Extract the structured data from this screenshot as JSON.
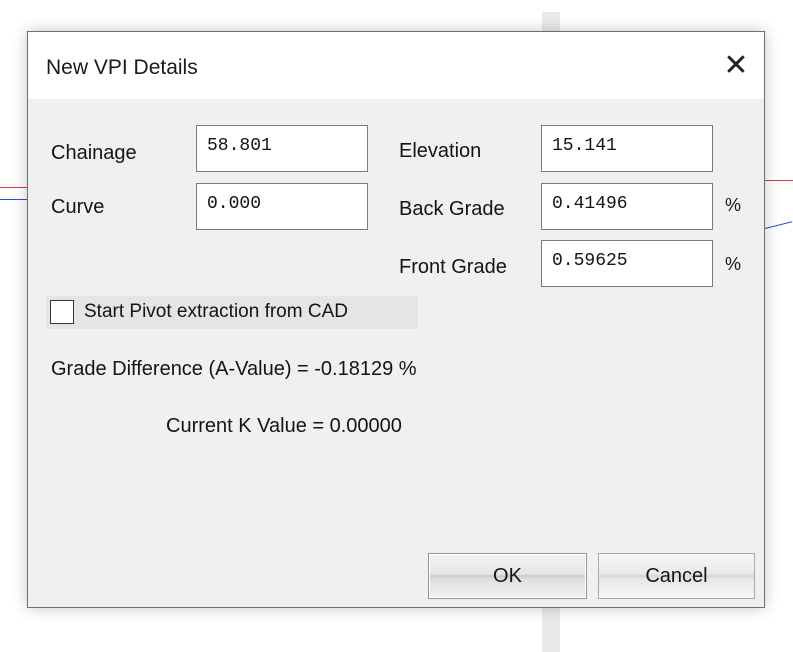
{
  "dialog": {
    "title": "New VPI Details",
    "close_label": "✕"
  },
  "fields": {
    "chainage": {
      "label": "Chainage",
      "value": "58.801"
    },
    "curve": {
      "label": "Curve",
      "value": "0.000"
    },
    "elevation": {
      "label": "Elevation",
      "value": "15.141"
    },
    "back_grade": {
      "label": "Back Grade",
      "value": "0.41496",
      "unit": "%"
    },
    "front_grade": {
      "label": "Front Grade",
      "value": "0.59625",
      "unit": "%"
    }
  },
  "checkbox": {
    "label": "Start Pivot extraction from CAD",
    "checked": false
  },
  "info": {
    "grade_difference": "Grade Difference (A-Value) = -0.18129 %",
    "current_k": "Current K Value = 0.00000"
  },
  "buttons": {
    "ok": "OK",
    "cancel": "Cancel"
  },
  "colors": {
    "canvas_red_line": "#e0383a",
    "canvas_blue_line": "#3050d8"
  }
}
